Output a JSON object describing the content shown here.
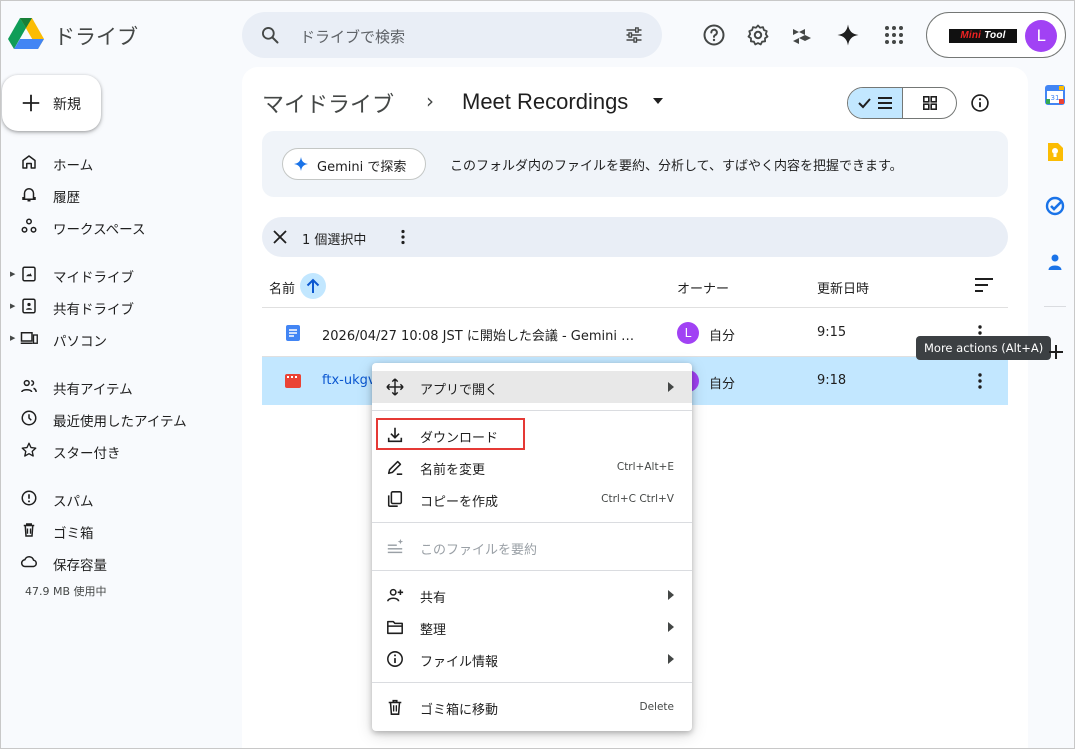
{
  "app": {
    "name": "ドライブ"
  },
  "search": {
    "placeholder": "ドライブで検索"
  },
  "account": {
    "brand_mini": "Mini",
    "brand_tool": "Tool",
    "avatar_letter": "L"
  },
  "sidebar": {
    "new_label": "新規",
    "items": [
      {
        "label": "ホーム",
        "icon": "home-icon"
      },
      {
        "label": "履歴",
        "icon": "bell-icon"
      },
      {
        "label": "ワークスペース",
        "icon": "workspace-icon"
      },
      {
        "label": "マイドライブ",
        "icon": "my-drive-icon",
        "expandable": true
      },
      {
        "label": "共有ドライブ",
        "icon": "shared-drive-icon",
        "expandable": true
      },
      {
        "label": "パソコン",
        "icon": "computer-icon",
        "expandable": true
      },
      {
        "label": "共有アイテム",
        "icon": "people-icon"
      },
      {
        "label": "最近使用したアイテム",
        "icon": "clock-icon"
      },
      {
        "label": "スター付き",
        "icon": "star-icon"
      },
      {
        "label": "スパム",
        "icon": "spam-icon"
      },
      {
        "label": "ゴミ箱",
        "icon": "trash-icon"
      },
      {
        "label": "保存容量",
        "icon": "cloud-icon"
      }
    ],
    "storage_used": "47.9 MB 使用中"
  },
  "breadcrumb": {
    "root": "マイドライブ",
    "separator": "›",
    "current": "Meet Recordings"
  },
  "gemini": {
    "button_label": "Gemini で探索",
    "description": "このフォルダ内のファイルを要約、分析して、すばやく内容を把握できます。"
  },
  "selection": {
    "text": "1 個選択中"
  },
  "table": {
    "headers": {
      "name": "名前",
      "owner": "オーナー",
      "modified": "更新日時"
    },
    "rows": [
      {
        "name": "2026/04/27 10:08 JST に開始した会議 - Gemini …",
        "owner_initial": "L",
        "owner": "自分",
        "modified": "9:15",
        "type": "doc"
      },
      {
        "name": "ftx-ukgv",
        "owner_initial": "L",
        "owner": "自分",
        "modified": "9:18",
        "type": "video"
      }
    ]
  },
  "tooltip": "More actions (Alt+A)",
  "context_menu": {
    "items": [
      {
        "label": "アプリで開く",
        "icon": "open-with-icon",
        "submenu": true
      },
      {
        "label": "ダウンロード",
        "icon": "download-icon"
      },
      {
        "label": "名前を変更",
        "icon": "rename-icon",
        "shortcut": "Ctrl+Alt+E"
      },
      {
        "label": "コピーを作成",
        "icon": "copy-icon",
        "shortcut": "Ctrl+C Ctrl+V"
      },
      {
        "label": "このファイルを要約",
        "icon": "summarize-icon",
        "disabled": true
      },
      {
        "label": "共有",
        "icon": "share-icon",
        "submenu": true
      },
      {
        "label": "整理",
        "icon": "folder-icon",
        "submenu": true
      },
      {
        "label": "ファイル情報",
        "icon": "info-icon",
        "submenu": true
      },
      {
        "label": "ゴミ箱に移動",
        "icon": "trash-icon",
        "shortcut": "Delete"
      }
    ]
  },
  "colors": {
    "accent": "#0b57d0",
    "selected": "#c2e7ff",
    "avatar": "#a142f4",
    "highlight_box": "#e53935"
  }
}
